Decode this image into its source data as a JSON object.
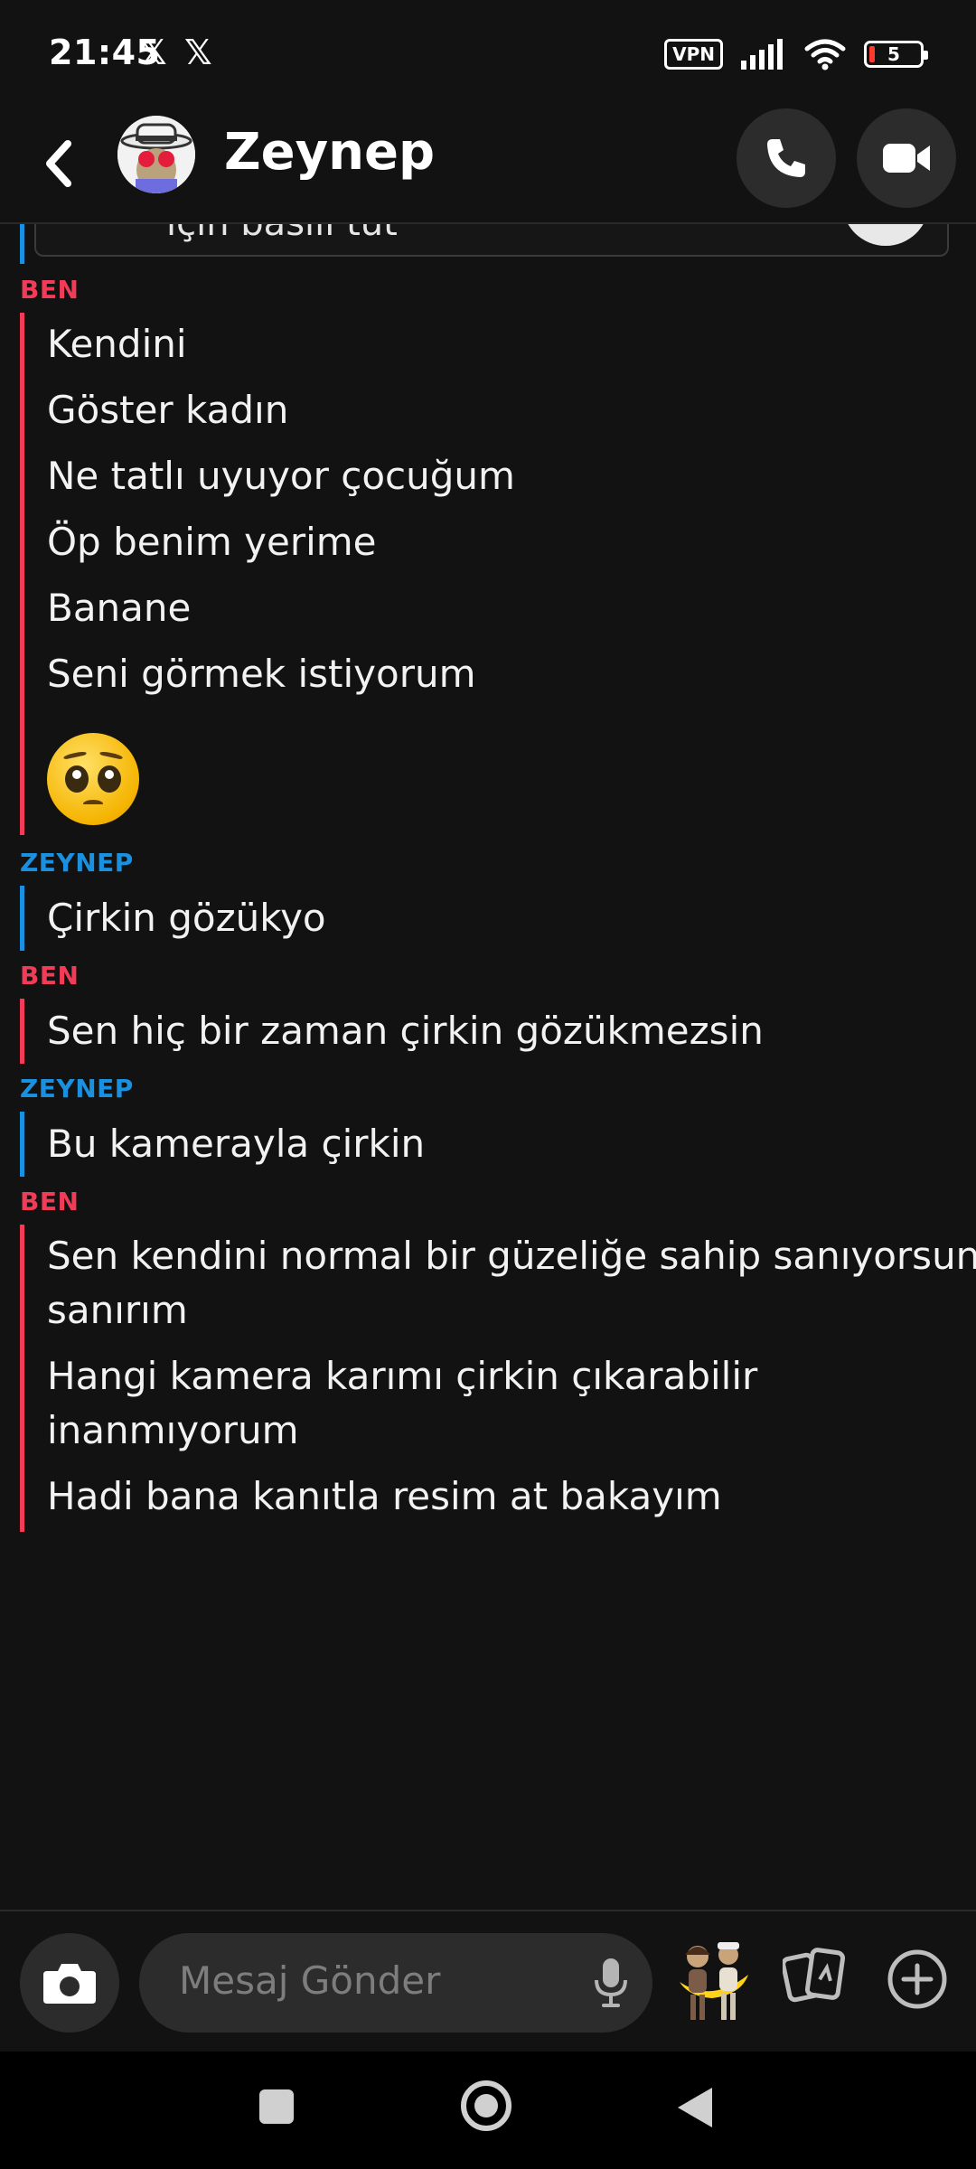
{
  "status_bar": {
    "time": "21:45",
    "x_icon_1": "𝕏",
    "x_icon_2": "𝕏",
    "vpn": "VPN",
    "battery": "5"
  },
  "header": {
    "contact_name": "Zeynep"
  },
  "chat": {
    "truncated_card_text": "için basılı tut",
    "groups": [
      {
        "sender": "BEN",
        "messages": [
          "Kendini",
          "Göster kadın",
          "Ne tatlı uyuyor çocuğum",
          "Öp benim yerime",
          "Banane",
          "Seni görmek istiyorum"
        ],
        "emoji": "pleading-face"
      },
      {
        "sender": "ZEYNEP",
        "messages": [
          "Çirkin gözükyo"
        ]
      },
      {
        "sender": "BEN",
        "messages": [
          "Sen hiç bir zaman çirkin gözükmezsin"
        ]
      },
      {
        "sender": "ZEYNEP",
        "messages": [
          "Bu kamerayla çirkin"
        ]
      },
      {
        "sender": "BEN",
        "messages": [
          "Sen kendini normal bir güzeliğe sahip sanıyorsun",
          "sanırım",
          "Hangi kamera karımı çirkin çıkarabilir",
          "inanmıyorum",
          "Hadi bana kanıtla resim at bakayım"
        ]
      }
    ]
  },
  "composer": {
    "placeholder": "Mesaj Gönder"
  },
  "colors": {
    "background": "#121212",
    "ben": "#f23c57",
    "zeynep": "#1a90e0"
  }
}
